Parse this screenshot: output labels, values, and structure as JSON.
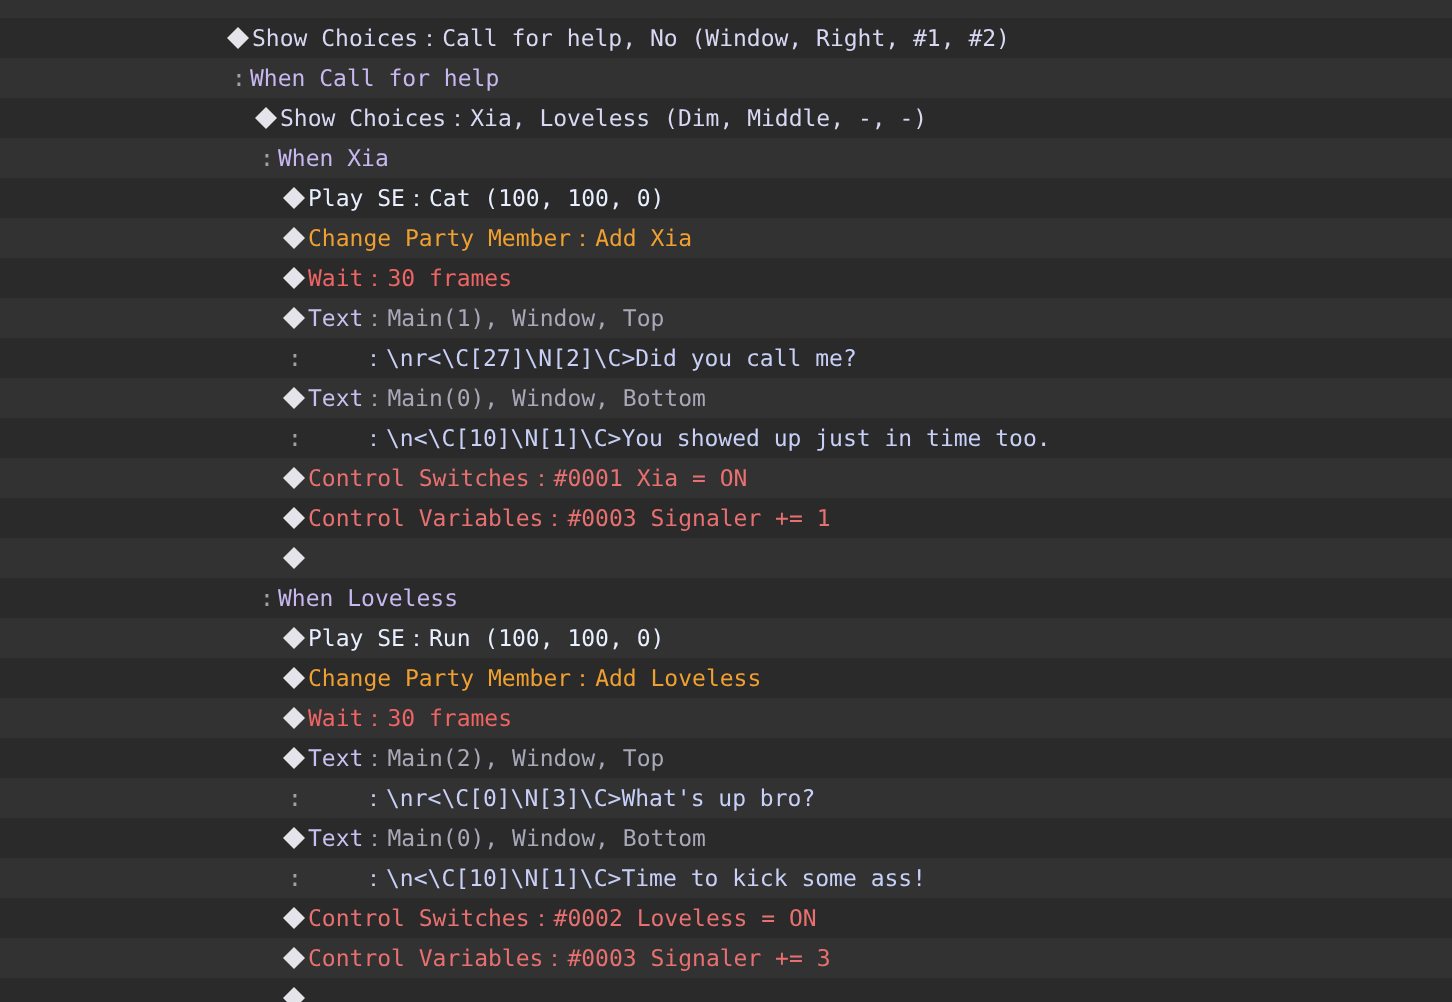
{
  "event_commands": [
    {
      "kind": "command",
      "name": "Show Choices",
      "color": "#d8d8f4",
      "params": "：Call for help, No (Window, Right, #1, #2)",
      "children": [
        {
          "kind": "branch",
          "marker": ":",
          "label": "When Call for help",
          "children": [
            {
              "kind": "command",
              "name": "Show Choices",
              "color": "#d8d8f4",
              "params": "：Xia, Loveless (Dim, Middle, -, -)",
              "children": [
                {
                  "kind": "branch",
                  "marker": ":",
                  "label": "When Xia",
                  "children": [
                    {
                      "kind": "command",
                      "name": "Play SE",
                      "color": "#e8f0ff",
                      "params": "：Cat (100, 100, 0)"
                    },
                    {
                      "kind": "command",
                      "name": "Change Party Member",
                      "color": "#f0a030",
                      "params": "：Add Xia"
                    },
                    {
                      "kind": "command",
                      "name": "Wait",
                      "color": "#f06464",
                      "params": "：30 frames"
                    },
                    {
                      "kind": "text",
                      "name": "Text",
                      "color": "#c8c0f0",
                      "params": "：Main(1), Window, Top",
                      "lines": [
                        {
                          "marker": ":",
                          "text": "：\\nr<\\C[27]\\N[2]\\C>Did you call me?"
                        }
                      ]
                    },
                    {
                      "kind": "text",
                      "name": "Text",
                      "color": "#c8c0f0",
                      "params": "：Main(0), Window, Bottom",
                      "lines": [
                        {
                          "marker": ":",
                          "text": "：\\n<\\C[10]\\N[1]\\C>You showed up just in time too."
                        }
                      ]
                    },
                    {
                      "kind": "command",
                      "name": "Control Switches",
                      "color": "#e87070",
                      "params": "：#0001 Xia = ON"
                    },
                    {
                      "kind": "command",
                      "name": "Control Variables",
                      "color": "#e87070",
                      "params": "：#0003 Signaler += 1"
                    },
                    {
                      "kind": "empty"
                    }
                  ]
                },
                {
                  "kind": "branch",
                  "marker": ":",
                  "label": "When Loveless",
                  "children": [
                    {
                      "kind": "command",
                      "name": "Play SE",
                      "color": "#e8f0ff",
                      "params": "：Run (100, 100, 0)"
                    },
                    {
                      "kind": "command",
                      "name": "Change Party Member",
                      "color": "#f0a030",
                      "params": "：Add Loveless"
                    },
                    {
                      "kind": "command",
                      "name": "Wait",
                      "color": "#f06464",
                      "params": "：30 frames"
                    },
                    {
                      "kind": "text",
                      "name": "Text",
                      "color": "#c8c0f0",
                      "params": "：Main(2), Window, Top",
                      "lines": [
                        {
                          "marker": ":",
                          "text": "：\\nr<\\C[0]\\N[3]\\C>What's up bro?"
                        }
                      ]
                    },
                    {
                      "kind": "text",
                      "name": "Text",
                      "color": "#c8c0f0",
                      "params": "：Main(0), Window, Bottom",
                      "lines": [
                        {
                          "marker": ":",
                          "text": "：\\n<\\C[10]\\N[1]\\C>Time to kick some ass!"
                        }
                      ]
                    },
                    {
                      "kind": "command",
                      "name": "Control Switches",
                      "color": "#e87070",
                      "params": "：#0002 Loveless = ON"
                    },
                    {
                      "kind": "command",
                      "name": "Control Variables",
                      "color": "#e87070",
                      "params": "：#0003 Signaler += 3"
                    },
                    {
                      "kind": "empty"
                    }
                  ]
                }
              ]
            }
          ]
        }
      ]
    }
  ]
}
